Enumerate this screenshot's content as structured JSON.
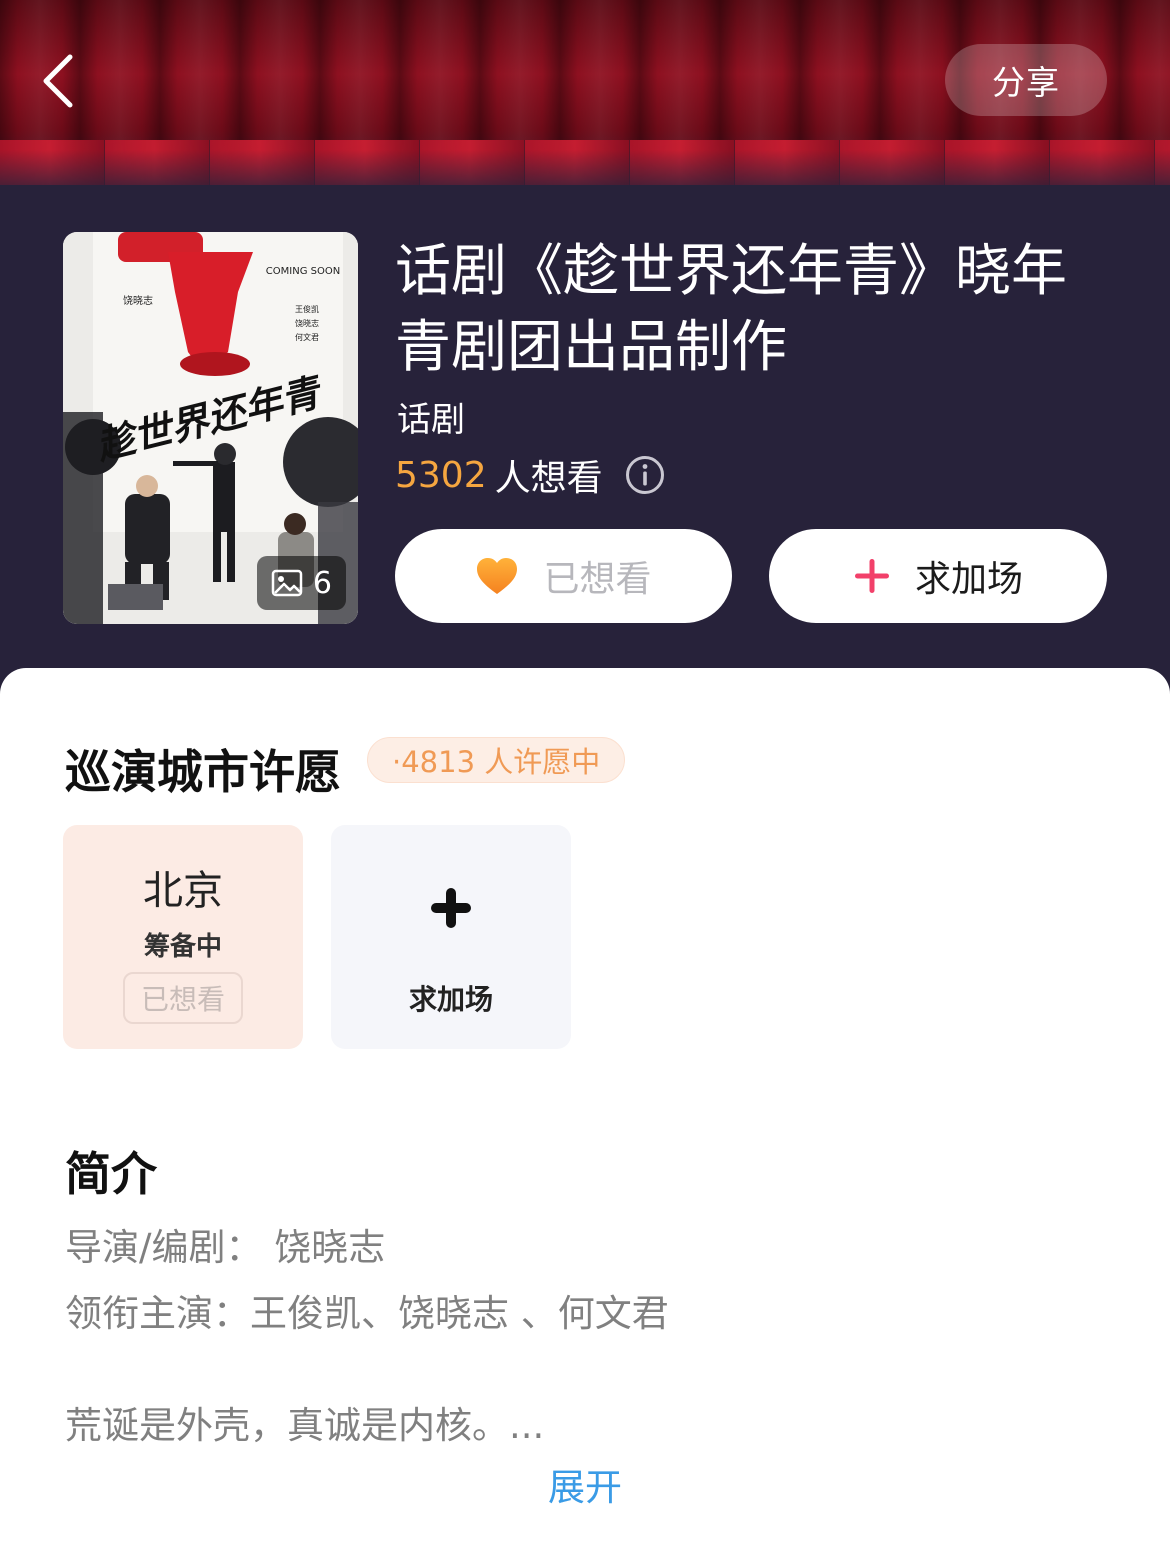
{
  "nav": {
    "back_icon": "chevron-left-icon",
    "share_label": "分享"
  },
  "poster": {
    "coming_soon": "COMING SOON",
    "poster_title": "趁世界还年青",
    "poster_credit": "饶晓志",
    "poster_cast": [
      "王俊凯",
      "饶晓志",
      "何文君"
    ],
    "image_count": "6"
  },
  "show": {
    "title": "话剧《趁世界还年青》晓年青剧团出品制作",
    "genre": "话剧",
    "want_count": "5302",
    "want_suffix": "人想看",
    "wanted_label": "已想看",
    "add_show_label": "求加场"
  },
  "tour": {
    "title": "巡演城市许愿",
    "badge": "·4813 人许愿中",
    "cities": [
      {
        "name": "北京",
        "status": "筹备中",
        "action": "已想看"
      }
    ],
    "add_label": "求加场"
  },
  "intro": {
    "title": "简介",
    "director": "导演/编剧： 饶晓志",
    "cast": "领衔主演：王俊凯、饶晓志 、何文君",
    "summary": "荒诞是外壳，真诚是内核。...",
    "expand": "展开"
  },
  "colors": {
    "accent_orange": "#f5a640",
    "heart_orange": "#f7941d",
    "plus_pink": "#f2406a",
    "link_blue": "#3a9be6",
    "header_bg": "#27223a"
  }
}
